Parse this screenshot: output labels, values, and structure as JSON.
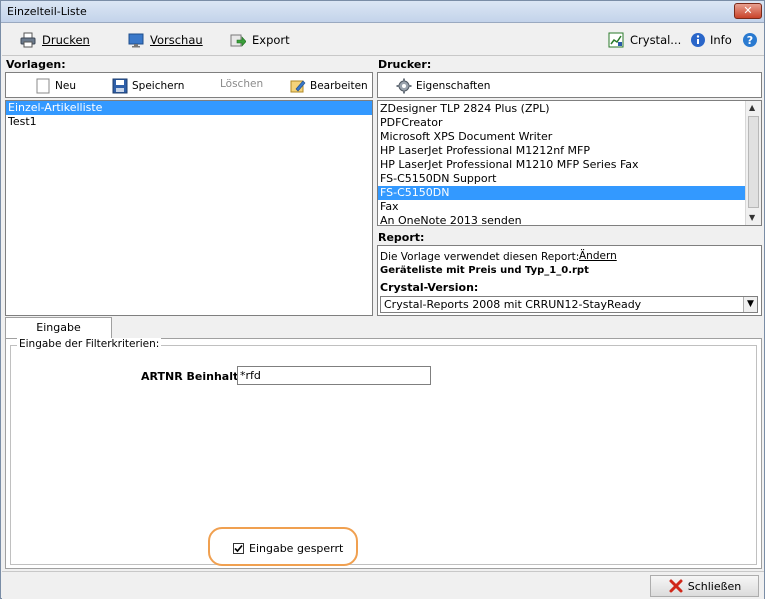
{
  "window": {
    "title": "Einzelteil-Liste",
    "close_glyph": "✕"
  },
  "toolbar": {
    "print_label": "Drucken",
    "preview_label": "Vorschau",
    "export_label": "Export",
    "crystal_label": "Crystal...",
    "info_label": "Info"
  },
  "templates": {
    "heading": "Vorlagen:",
    "new_label": "Neu",
    "save_label": "Speichern",
    "delete_label": "Löschen",
    "edit_label": "Bearbeiten",
    "items": [
      "Einzel-Artikelliste",
      "Test1"
    ],
    "selected_index": 0
  },
  "printers": {
    "heading": "Drucker:",
    "properties_label": "Eigenschaften",
    "items": [
      "ZDesigner TLP 2824 Plus (ZPL)",
      "PDFCreator",
      "Microsoft XPS Document Writer",
      "HP LaserJet Professional M1212nf MFP",
      "HP LaserJet Professional M1210 MFP Series Fax",
      "FS-C5150DN Support",
      "FS-C5150DN",
      "Fax",
      "An OneNote 2013 senden"
    ],
    "selected_index": 6
  },
  "report": {
    "heading": "Report:",
    "uses_text": "Die Vorlage verwendet diesen Report:",
    "change_label": "Ändern",
    "filename": "Geräteliste mit Preis und Typ_1_0.rpt",
    "crystal_heading": "Crystal-Version:",
    "crystal_value": "Crystal-Reports 2008 mit CRRUN12-StayReady"
  },
  "input_tab": {
    "tab_label": "Eingabe",
    "group_title": "Eingabe der Filterkriterien:",
    "artnr_label": "ARTNR Beinhaltet",
    "artnr_value": "*rfd",
    "lock_label": "Eingabe gesperrt",
    "lock_checked": true
  },
  "footer": {
    "close_label": "Schließen"
  },
  "colors": {
    "selection": "#3399ff",
    "highlight": "#f0a050"
  }
}
